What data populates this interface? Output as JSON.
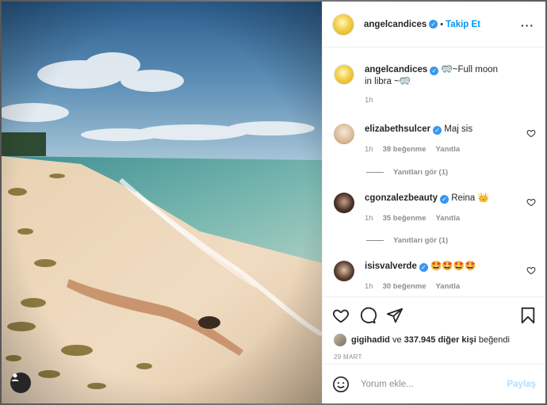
{
  "post": {
    "image_description_icon": "user-tag-icon"
  },
  "header": {
    "username": "angelcandices",
    "separator": "•",
    "follow_label": "Takip Et",
    "more_icon": "more-options-icon"
  },
  "caption": {
    "username": "angelcandices",
    "text": "~Full moon in libra ~",
    "time": "1h"
  },
  "comments": [
    {
      "username": "elizabethsulcer",
      "text": "Maj sis",
      "time": "1h",
      "likes": "38 beğenme",
      "reply": "Yanıtla",
      "view_replies": "Yanıtları gör (1)"
    },
    {
      "username": "cgonzalezbeauty",
      "text": "Reina 👑",
      "time": "1h",
      "likes": "35 beğenme",
      "reply": "Yanıtla",
      "view_replies": "Yanıtları gör (1)"
    },
    {
      "username": "isisvalverde",
      "text": "🤩🤩🤩🤩",
      "time": "1h",
      "likes": "30 beğenme",
      "reply": "Yanıtla"
    }
  ],
  "likes_line": {
    "user": "gigihadid",
    "connector": "ve",
    "count": "337.945 diğer kişi",
    "suffix": "beğendi"
  },
  "date": "29 MART",
  "comment_box": {
    "placeholder": "Yorum ekle...",
    "post_label": "Paylaş"
  },
  "colors": {
    "accent": "#0095f6",
    "verified": "#3897f0",
    "muted": "#8e8e8e"
  }
}
